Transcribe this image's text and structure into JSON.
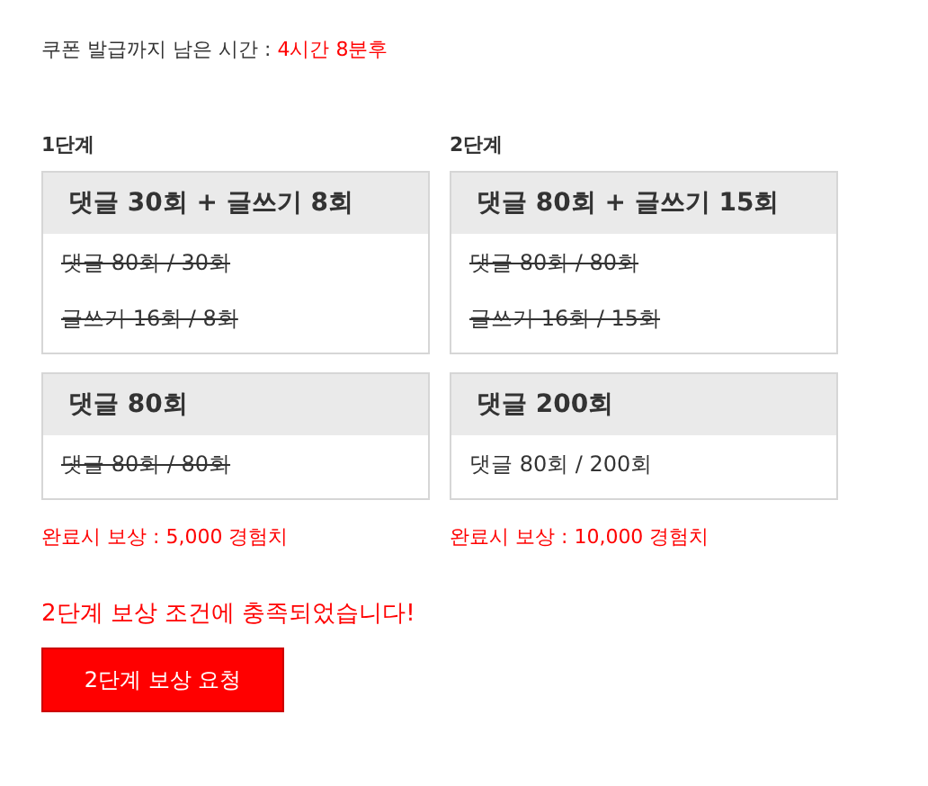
{
  "timer": {
    "label": "쿠폰 발급까지 남은 시간 : ",
    "value": "4시간 8분후"
  },
  "stages": [
    {
      "title": "1단계",
      "cards": [
        {
          "heading": "댓글 30회 + 글쓰기 8회",
          "items": [
            {
              "text": "댓글 80회 / 30회",
              "done": true
            },
            {
              "text": "글쓰기 16회 / 8회",
              "done": true
            }
          ]
        },
        {
          "heading": "댓글 80회",
          "items": [
            {
              "text": "댓글 80회 / 80회",
              "done": true
            }
          ]
        }
      ],
      "reward": "완료시 보상 : 5,000 경험치"
    },
    {
      "title": "2단계",
      "cards": [
        {
          "heading": "댓글 80회 + 글쓰기 15회",
          "items": [
            {
              "text": "댓글 80회 / 80회",
              "done": true
            },
            {
              "text": "글쓰기 16회 / 15회",
              "done": true
            }
          ]
        },
        {
          "heading": "댓글 200회",
          "items": [
            {
              "text": "댓글 80회 / 200회",
              "done": false
            }
          ]
        }
      ],
      "reward": "완료시 보상 : 10,000 경험치"
    }
  ],
  "message": "2단계 보상 조건에 충족되었습니다!",
  "button": "2단계 보상 요청"
}
